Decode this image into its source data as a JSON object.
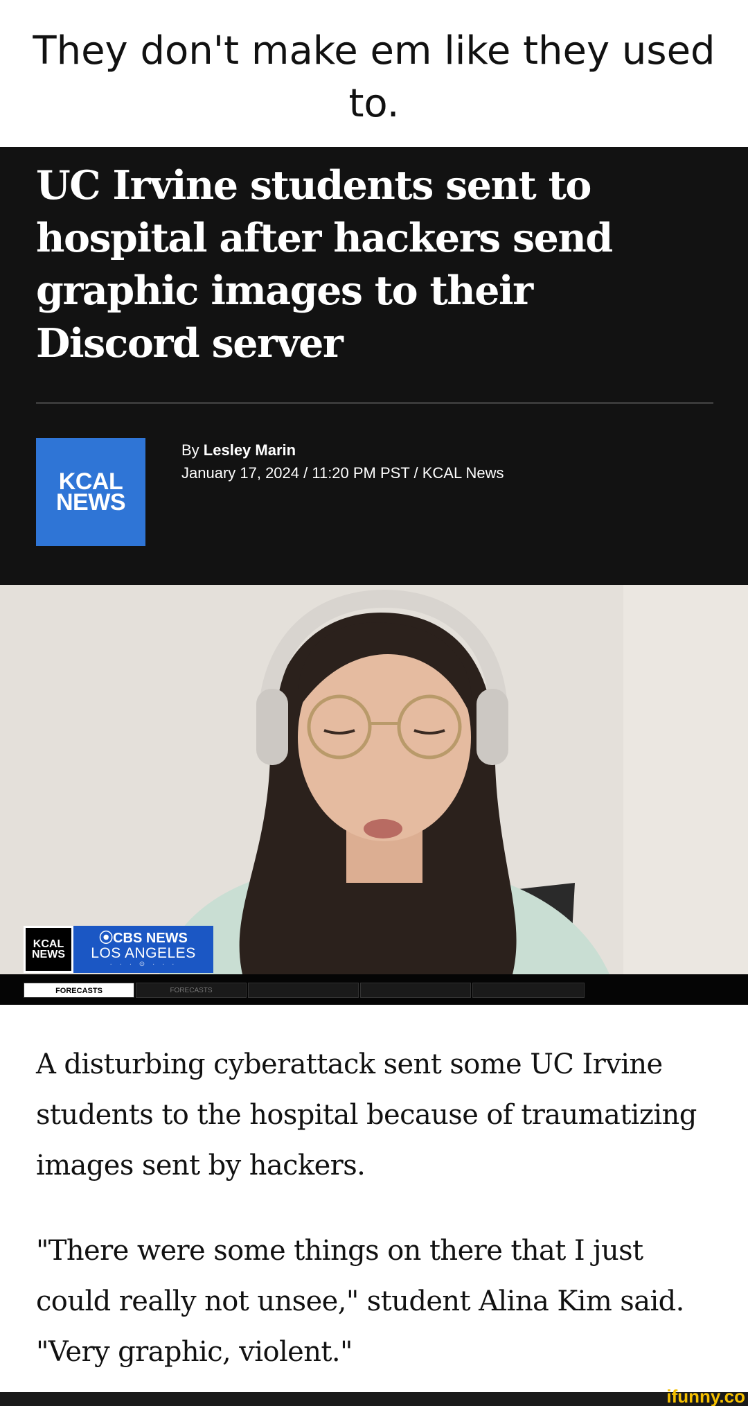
{
  "meme": {
    "caption": "They don't make em like they used to."
  },
  "article": {
    "headline": "UC Irvine students sent to hospital after hackers send graphic images to their Discord server",
    "logo": {
      "line1": "KCAL",
      "line2": "NEWS"
    },
    "byline_prefix": "By ",
    "author": "Lesley Marin",
    "dateline": "January 17, 2024 / 11:20 PM PST / KCAL News",
    "paragraphs": [
      "A disturbing cyberattack sent some UC Irvine students to the hospital because of traumatizing images sent by hackers.",
      "\"There were some things on there that I just could really not unsee,\" student Alina Kim said. \"Very graphic, violent.\""
    ]
  },
  "video": {
    "bug": {
      "kcal_line1": "KCAL",
      "kcal_line2": "NEWS",
      "network": "⦿CBS NEWS",
      "city": "LOS ANGELES",
      "dots": "· · · ⊙ · · ·"
    },
    "ticker": {
      "active_tab": "FORECASTS",
      "next_tab": "FORECASTS"
    }
  },
  "watermark": "ifunny.co",
  "colors": {
    "header_bg": "#121212",
    "logo_blue": "#2f75d6",
    "cbs_blue": "#1b57c4",
    "watermark_yellow": "#f5c000"
  }
}
